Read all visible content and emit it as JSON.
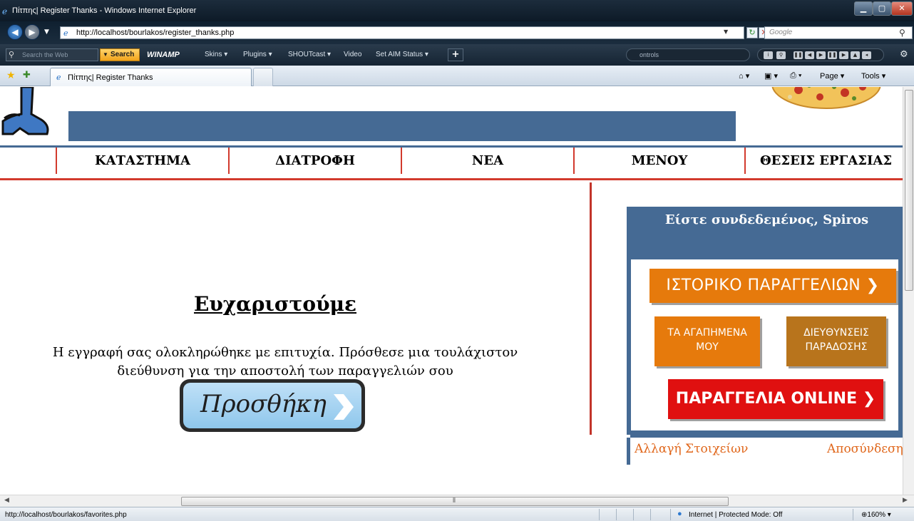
{
  "window": {
    "title": "Πίτπης| Register Thanks - Windows Internet Explorer"
  },
  "address_bar": {
    "url": "http://localhost/bourlakos/register_thanks.php",
    "search_placeholder": "Google"
  },
  "toolbar": {
    "web_search_placeholder": "Search the Web",
    "search_label": "Search",
    "winamp_label": "WINAMP",
    "skins_label": "Skins ▾",
    "plugins_label": "Plugins ▾",
    "shoutcast_label": "SHOUTcast ▾",
    "video_label": "Video",
    "aim_label": "Set AIM Status ▾",
    "controls_label": "ontrols"
  },
  "tabs": {
    "active_title": "Πίτπης| Register Thanks",
    "page_label": "Page ▾",
    "tools_label": "Tools ▾"
  },
  "nav": {
    "items": [
      "ΚΑΤΑΣΤΗΜΑ",
      "ΔΙΑΤΡΟΦΗ",
      "ΝΕΑ",
      "ΜΕΝΟΥ",
      "ΘΕΣΕΙΣ ΕΡΓΑΣΙΑΣ"
    ]
  },
  "main": {
    "title": "Ευχαριστούμε",
    "message_line1": "Η εγγραφή σας ολοκληρώθηκε με επιτυχία. Πρόσθεσε μια τουλάχιστον",
    "message_line2": "διεύθυνση για την αποστολή των παραγγελιών σου",
    "add_button_label": "Προσθήκη"
  },
  "user_panel": {
    "greeting": "Είστε συνδεδεμένος, Spiros",
    "history_button": "ΙΣΤΟΡΙΚΟ ΠΑΡΑΓΓΕΛΙΩΝ ❯",
    "favorites_line1": "ΤΑ ΑΓΑΠΗΜΕΝΑ",
    "favorites_line2": "ΜΟΥ",
    "addresses_line1": "ΔΙΕΥΘΥΝΣΕΙΣ",
    "addresses_line2": "ΠΑΡΑΔΟΣΗΣ",
    "order_button": "ΠΑΡΑΓΓΕΛΙΑ ONLINE ❯",
    "change_details_link": "Αλλαγή Στοιχείων",
    "logout_link": "Αποσύνδεση"
  },
  "status_bar": {
    "status_text": "http://localhost/bourlakos/favorites.php",
    "zone_text": "Internet | Protected Mode: Off",
    "zoom_text": "⊕160%  ▾"
  },
  "colors": {
    "brand_blue": "#456a94",
    "nav_red": "#d23a2d",
    "orange": "#e67a0c",
    "order_red": "#e01010",
    "link_orange": "#e0661a"
  }
}
